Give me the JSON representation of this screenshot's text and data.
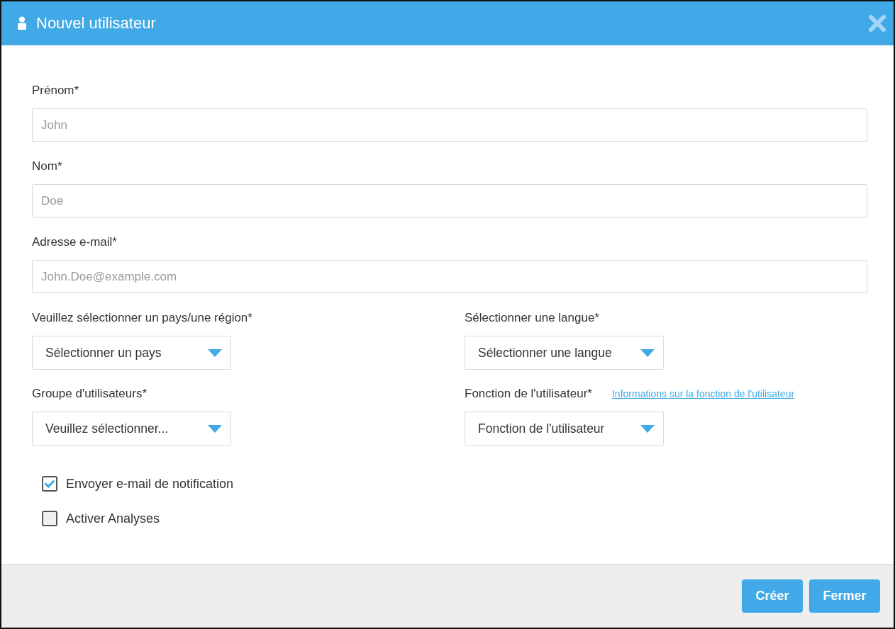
{
  "window": {
    "title": "Nouvel utilisateur"
  },
  "text_fields": [
    {
      "label": "Prénom*",
      "placeholder": "John"
    },
    {
      "label": "Nom*",
      "placeholder": "Doe"
    },
    {
      "label": "Adresse e-mail*",
      "placeholder": "John.Doe@example.com"
    }
  ],
  "selects": [
    {
      "label": "Veuillez sélectionner un pays/une région*",
      "value": "Sélectionner un pays"
    },
    {
      "label": "Sélectionner une langue*",
      "value": "Sélectionner une langue"
    },
    {
      "label": "Groupe d'utilisateurs*",
      "value": "Veuillez sélectionner..."
    },
    {
      "label": "Fonction de l'utilisateur*",
      "value": "Fonction de l'utilisateur",
      "link": "Informations sur la fonction de l'utilisateur"
    }
  ],
  "checkboxes": [
    {
      "label": "Envoyer e-mail de notification",
      "checked": true
    },
    {
      "label": "Activer Analyses",
      "checked": false
    }
  ],
  "buttons": [
    "Créer",
    "Fermer"
  ]
}
